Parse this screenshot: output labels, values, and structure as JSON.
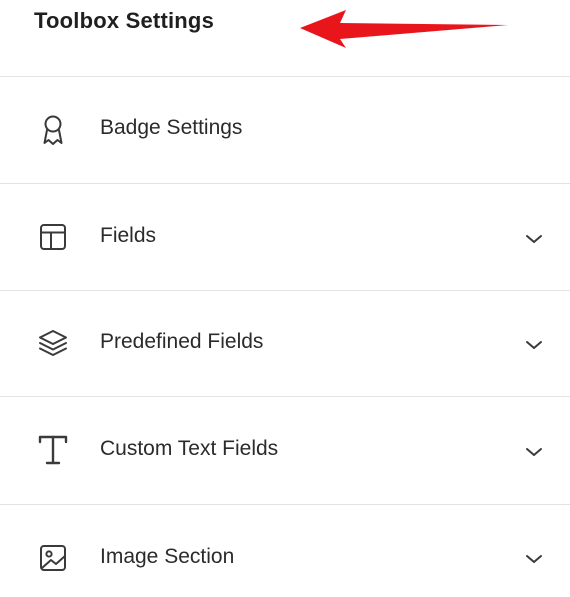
{
  "header": {
    "title": "Toolbox Settings"
  },
  "menu": {
    "items": [
      {
        "label": "Badge Settings",
        "icon": "badge-ribbon-icon",
        "has_chevron": false
      },
      {
        "label": "Fields",
        "icon": "layout-panel-icon",
        "has_chevron": true
      },
      {
        "label": "Predefined Fields",
        "icon": "stack-layers-icon",
        "has_chevron": true
      },
      {
        "label": "Custom Text Fields",
        "icon": "text-type-icon",
        "has_chevron": true
      },
      {
        "label": "Image Section",
        "icon": "image-icon",
        "has_chevron": true
      }
    ]
  },
  "colors": {
    "arrow": "#e8161b",
    "divider": "#e3e3e3",
    "text": "#2b2b2b",
    "icon": "#3a3a3a"
  }
}
